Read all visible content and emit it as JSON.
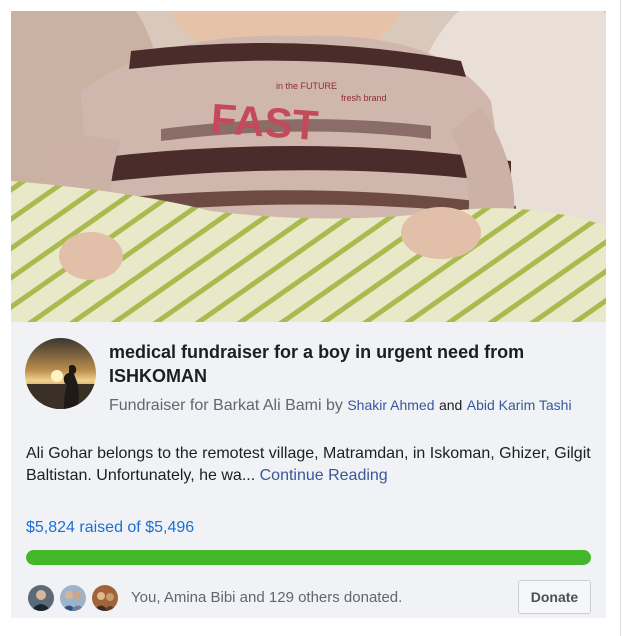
{
  "post": {
    "title": "medical fundraiser for a boy in urgent need from ISHKOMAN",
    "subtitle_prefix": "Fundraiser for Barkat Ali Bami by",
    "organizer_1": "Shakir Ahmed",
    "and": "and",
    "organizer_2": "Abid Karim Tashi",
    "description": "Ali Gohar belongs to the remotest village, Matramdan, in Iskoman, Ghizer, Gilgit Baltistan. Unfortunately, he wa...",
    "continue_reading": "Continue Reading",
    "raised_text": "$5,824 raised of $5,496",
    "progress_fraction": 1.0,
    "donated_text": "You, Amina Bibi and 129 others donated.",
    "donate_label": "Donate"
  },
  "hero_shirt_text": {
    "line1": "in the FUTURE",
    "brand": "fresh brand",
    "word": "FAST"
  },
  "colors": {
    "link": "#385898",
    "raised": "#1d6fd4",
    "progress": "#42b72a",
    "card_bg": "#f0f2f5"
  }
}
